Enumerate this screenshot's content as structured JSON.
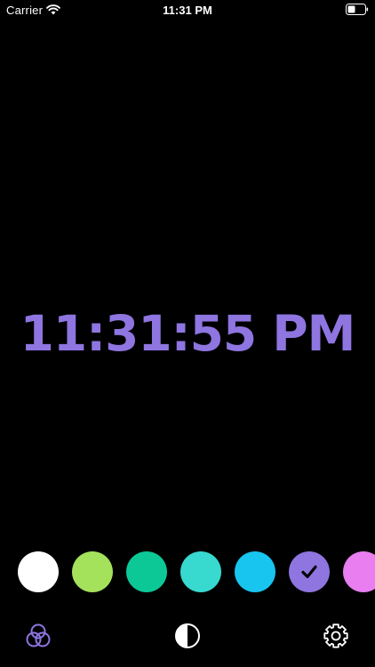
{
  "status_bar": {
    "carrier": "Carrier",
    "time": "11:31 PM",
    "signal_icon": "wifi-icon",
    "battery_icon": "battery-icon"
  },
  "clock": {
    "time": "11:31:55 PM",
    "color": "#8e75e0"
  },
  "swatches": [
    {
      "color": "#ffffff",
      "selected": false
    },
    {
      "color": "#a4e25c",
      "selected": false
    },
    {
      "color": "#0cc897",
      "selected": false
    },
    {
      "color": "#38d9cf",
      "selected": false
    },
    {
      "color": "#18c5ef",
      "selected": false
    },
    {
      "color": "#8e75e0",
      "selected": true
    },
    {
      "color": "#e87ef0",
      "selected": false
    }
  ],
  "toolbar": {
    "color_mode_icon": "color-circles-icon",
    "contrast_icon": "contrast-icon",
    "settings_icon": "gear-icon"
  }
}
